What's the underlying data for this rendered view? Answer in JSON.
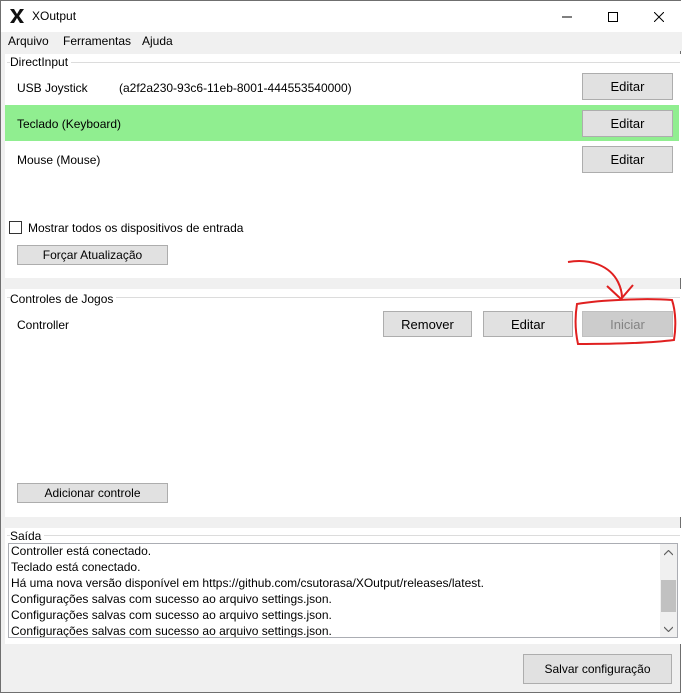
{
  "window": {
    "title": "XOutput",
    "controls": {
      "minimize": "minimize-icon",
      "maximize": "maximize-icon",
      "close": "close-icon"
    }
  },
  "menu": [
    "Arquivo",
    "Ferramentas",
    "Ajuda"
  ],
  "directinput": {
    "title": "DirectInput",
    "devices": [
      {
        "name": "USB Joystick",
        "id": "(a2f2a230-93c6-11eb-8001-444553540000)",
        "button": "Editar",
        "selected": false
      },
      {
        "name": "Teclado (Keyboard)",
        "id": "",
        "button": "Editar",
        "selected": true
      },
      {
        "name": "Mouse (Mouse)",
        "id": "",
        "button": "Editar",
        "selected": false
      }
    ],
    "show_all_label": "Mostrar todos os dispositivos de entrada",
    "show_all_checked": false,
    "refresh_button": "Forçar Atualização"
  },
  "controllers": {
    "title": "Controles de Jogos",
    "items": [
      {
        "name": "Controller",
        "remove": "Remover",
        "edit": "Editar",
        "start": "Iniciar"
      }
    ],
    "add_button": "Adicionar controle"
  },
  "output": {
    "title": "Saída",
    "lines": [
      "Controller está conectado.",
      "Teclado está conectado.",
      "Há uma nova versão disponível em https://github.com/csutorasa/XOutput/releases/latest.",
      "Configurações salvas com sucesso ao arquivo settings.json.",
      "Configurações salvas com sucesso ao arquivo settings.json.",
      "Configurações salvas com sucesso ao arquivo settings.json."
    ]
  },
  "save_button": "Salvar configuração",
  "colors": {
    "selected_row": "#90ee90",
    "annotation": "#e02020"
  }
}
